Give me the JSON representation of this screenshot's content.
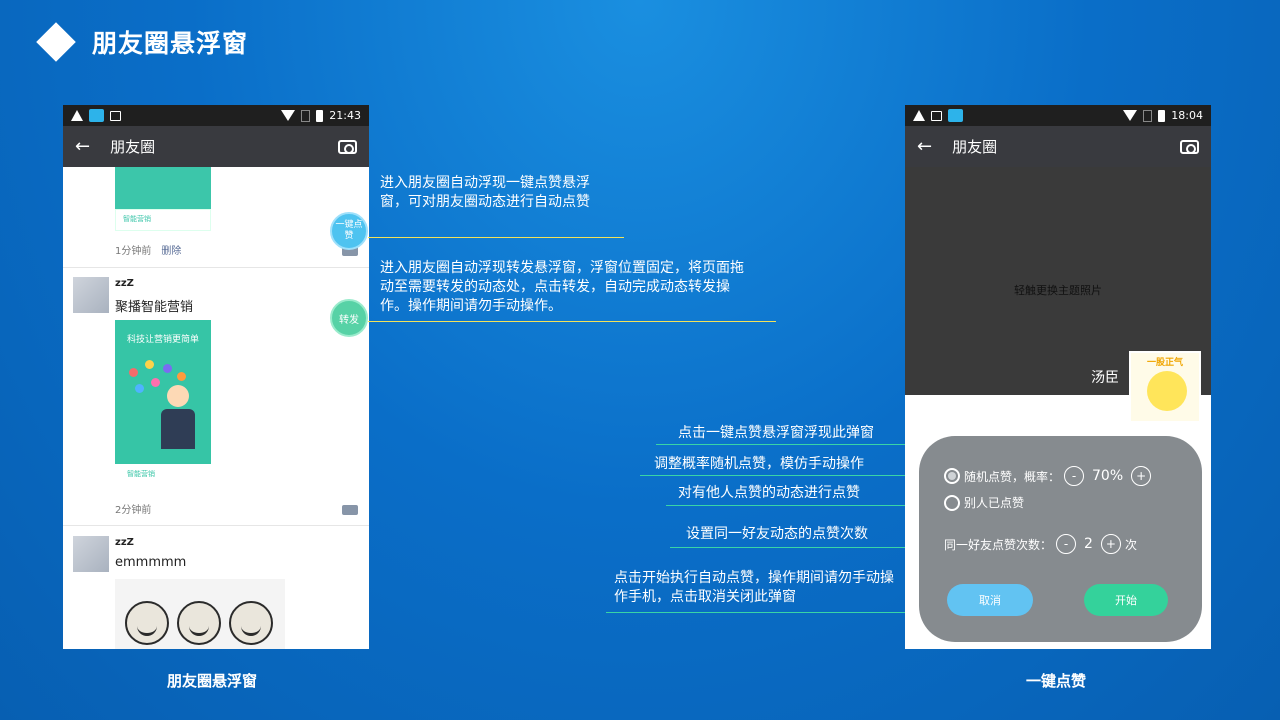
{
  "slide": {
    "title": "朋友圈悬浮窗"
  },
  "left_phone": {
    "status": {
      "time": "21:43"
    },
    "appbar": {
      "title": "朋友圈"
    },
    "post1": {
      "brand": "智能营销",
      "time": "1分钟前",
      "delete": "删除"
    },
    "post2": {
      "zzz": "zzZ",
      "user": "聚播智能营销",
      "poster_title": "科技让营销更简单",
      "brand": "智能营销",
      "time": "2分钟前"
    },
    "post3": {
      "zzz": "zzZ",
      "user": "emmmmm"
    },
    "float_like": "一键点赞",
    "float_forward": "转发",
    "caption": "朋友圈悬浮窗"
  },
  "annotations": {
    "like_float": "进入朋友圈自动浮现一键点赞悬浮窗，可对朋友圈动态进行自动点赞",
    "forward_float": "进入朋友圈自动浮现转发悬浮窗，浮窗位置固定，将页面拖动至需要转发的动态处，点击转发，自动完成动态转发操作。操作期间请勿手动操作。",
    "popup": "点击一键点赞悬浮窗浮现此弹窗",
    "random_prob": "调整概率随机点赞，模仿手动操作",
    "others_liked": "对有他人点赞的动态进行点赞",
    "same_friend": "设置同一好友动态的点赞次数",
    "start_cancel": "点击开始执行自动点赞，操作期间请勿手动操作手机，点击取消关闭此弹窗"
  },
  "right_phone": {
    "status": {
      "time": "18:04"
    },
    "appbar": {
      "title": "朋友圈"
    },
    "cover_hint": "轻触更换主题照片",
    "owner": "汤臣",
    "avatar_text": "一股正气",
    "dialog": {
      "random_label": "随机点赞，概率：",
      "minus": "-",
      "plus": "+",
      "prob_value": "70%",
      "others_label": "别人已点赞",
      "count_label": "同一好友点赞次数：",
      "count_value": "2",
      "count_unit": "次",
      "cancel": "取消",
      "start": "开始"
    },
    "caption": "一键点赞"
  }
}
